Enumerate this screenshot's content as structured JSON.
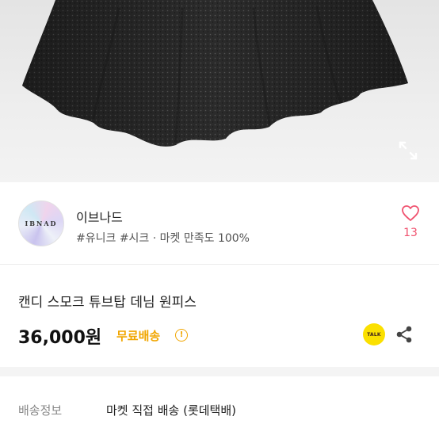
{
  "photo": {
    "expand_icon": "expand-icon"
  },
  "seller": {
    "avatar_text": "IBNAD",
    "name": "이브나드",
    "tags": "#유니크 #시크 · 마켓 만족도 100%",
    "like_icon": "heart-icon",
    "like_count": "13"
  },
  "product": {
    "title": "캔디 스모크 튜브탑 데님 원피스",
    "price": "36,000원",
    "free_shipping": "무료배송",
    "info_icon_text": "!",
    "talk_label": "TALK",
    "share_icon": "share-icon"
  },
  "shipping": {
    "label": "배송정보",
    "value": "마켓 직접 배송 (롯데택배)"
  },
  "colors": {
    "like": "#f0526f",
    "free_shipping": "#f1a600",
    "kakao": "#fbe000"
  }
}
